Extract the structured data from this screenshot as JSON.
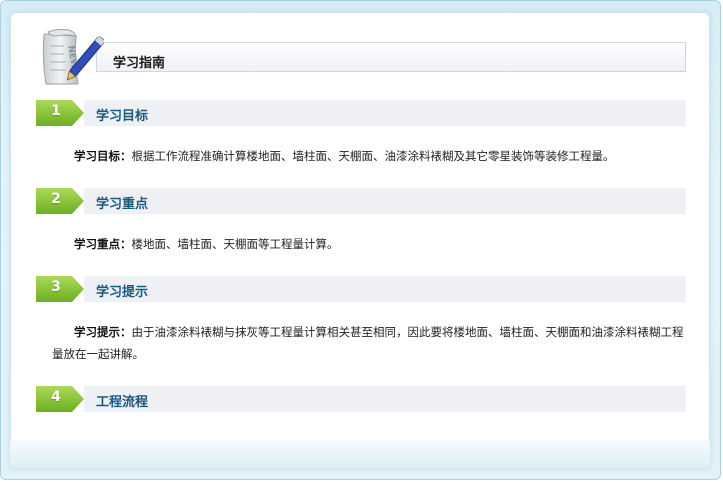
{
  "colors": {
    "accent_green": "#8cc63f",
    "title_blue": "#1b5a80",
    "frame_blue": "#a9d3e3"
  },
  "header": {
    "icon": "news-newspaper-pen-icon",
    "title": "学习指南"
  },
  "sections": [
    {
      "number": "1",
      "title": "学习目标",
      "lead": "学习目标：",
      "body": "根据工作流程准确计算楼地面、墙柱面、天棚面、油漆涂料裱糊及其它零星装饰等装修工程量。"
    },
    {
      "number": "2",
      "title": "学习重点",
      "lead": "学习重点：",
      "body": "楼地面、墙柱面、天棚面等工程量计算。"
    },
    {
      "number": "3",
      "title": "学习提示",
      "lead": "学习提示：",
      "body": "由于油漆涂料裱糊与抹灰等工程量计算相关甚至相同，因此要将楼地面、墙柱面、天棚面和油漆涂料裱糊工程量放在一起讲解。"
    },
    {
      "number": "4",
      "title": "工程流程"
    }
  ]
}
